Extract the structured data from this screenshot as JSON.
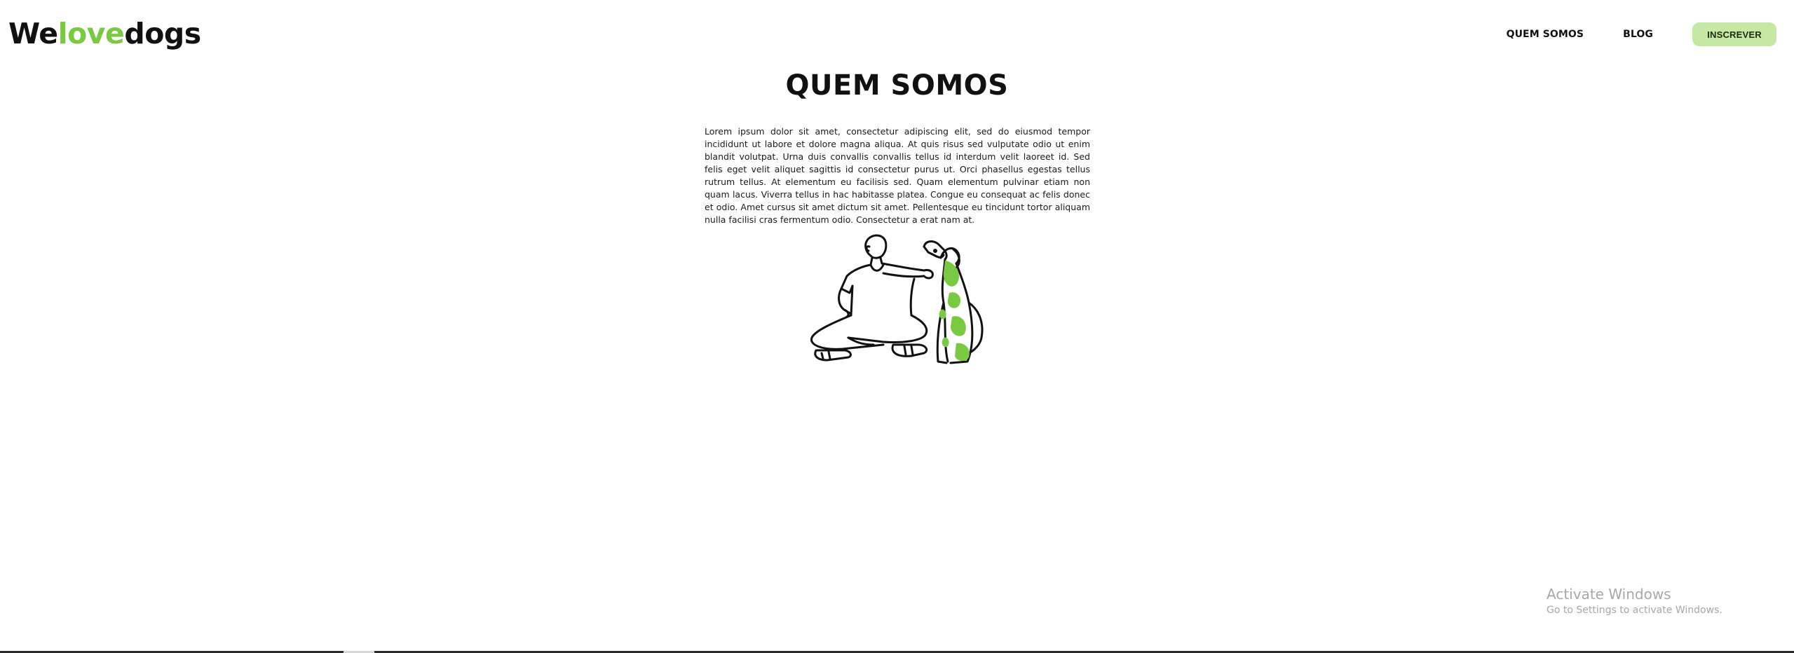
{
  "header": {
    "logo": {
      "part1": "We",
      "part2": "love",
      "part3": "dogs"
    },
    "nav": {
      "about_label": "QUEM SOMOS",
      "blog_label": "BLOG",
      "cta_label": "INSCREVER"
    }
  },
  "main": {
    "title": "QUEM SOMOS",
    "paragraph": "Lorem ipsum dolor sit amet, consectetur adipiscing elit, sed do eiusmod tempor incididunt ut labore et dolore magna aliqua. At quis risus sed vulputate odio ut enim blandit volutpat. Urna duis convallis convallis tellus id interdum velit laoreet id. Sed felis eget velit aliquet sagittis id consectetur purus ut. Orci phasellus egestas tellus rutrum tellus. At elementum eu facilisis sed. Quam elementum pulvinar etiam non quam lacus. Viverra tellus in hac habitasse platea. Congue eu consequat ac felis donec et odio. Amet cursus sit amet dictum sit amet. Pellentesque eu tincidunt tortor aliquam nulla facilisi cras fermentum odio. Consectetur a erat nam at.",
    "illustration_icon": "person-with-dog-illustration"
  },
  "watermark": {
    "title": "Activate Windows",
    "subtitle": "Go to Settings to activate Windows."
  },
  "colors": {
    "accent": "#7ac943",
    "cta_bg": "#c5e8a4",
    "text": "#111111"
  }
}
